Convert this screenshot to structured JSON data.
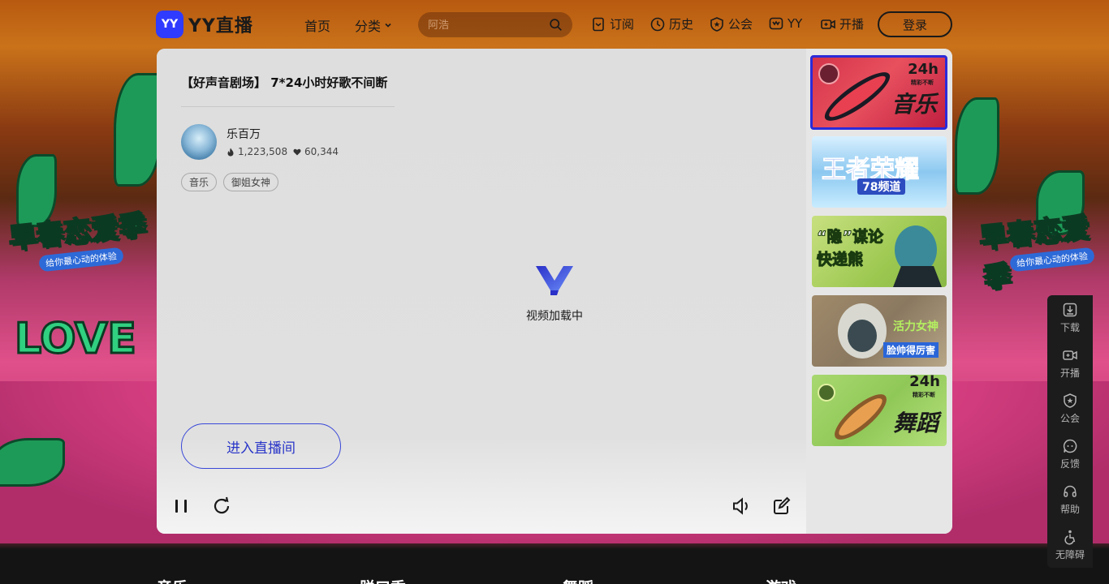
{
  "header": {
    "logo_mark": "YY",
    "logo_text": "YY直播",
    "nav": {
      "home": "首页",
      "category": "分类"
    },
    "search": {
      "placeholder": "阿浩"
    },
    "tools": {
      "subscribe": "订阅",
      "history": "历史",
      "guild": "公会",
      "yy": "YY",
      "broadcast": "开播"
    },
    "login": "登录"
  },
  "player": {
    "title": "【好声音剧场】 7*24小时好歌不间断",
    "streamer": "乐百万",
    "hot_count": "1,223,508",
    "like_count": "60,344",
    "tags": [
      "音乐",
      "御姐女神"
    ],
    "loading_text": "视频加载中",
    "enter_room": "进入直播间"
  },
  "rail": {
    "thumbs": [
      {
        "label": "音乐",
        "badge": "24h",
        "badge_sub": "精彩不断"
      },
      {
        "label": "王者荣耀",
        "badge": "78频道"
      },
      {
        "label": "“隐”谋论 快递熊"
      },
      {
        "label": "活力女神",
        "badge": "脸帅得厉害"
      },
      {
        "label": "舞蹈",
        "badge": "24h",
        "badge_sub": "精彩不断"
      }
    ]
  },
  "float_panel": {
    "download": "下载",
    "broadcast": "开播",
    "guild": "公会",
    "feedback": "反馈",
    "help": "帮助",
    "accessibility": "无障碍"
  },
  "background": {
    "banner": "早春恋爱季",
    "banner_sub": "给你最心动的体验",
    "love": "LOVE"
  },
  "footer": {
    "categories": [
      "音乐",
      "脱口秀",
      "舞蹈",
      "游戏"
    ]
  },
  "colors": {
    "brand": "#2f3bff",
    "active_border": "#2b2bd8",
    "enter_button": "#2a36c8"
  }
}
